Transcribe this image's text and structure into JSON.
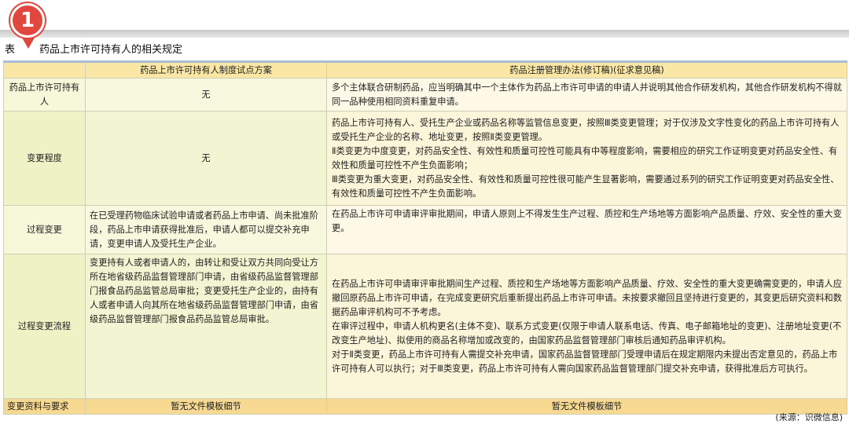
{
  "badge": {
    "number": "1"
  },
  "title": {
    "label": "表",
    "text": "药品上市许可持有人的相关规定"
  },
  "table": {
    "headers": [
      "",
      "药品上市许可持有人制度试点方案",
      "药品注册管理办法(修订稿)(征求意见稿)"
    ],
    "rows": [
      {
        "header": "药品上市许可持有人",
        "pilot": [
          "无"
        ],
        "rules": [
          "多个主体联合研制药品，应当明确其中一个主体作为药品上市许可申请的申请人并说明其他合作研发机构，其他合作研发机构不得就同一品种使用相同资料重复申请。"
        ]
      },
      {
        "header": "变更程度",
        "pilot": [
          "无"
        ],
        "rules": [
          "药品上市许可持有人、受托生产企业或药品名称等监管信息变更，按照Ⅲ类变更管理；对于仅涉及文字性变化的药品上市许可持有人或受托生产企业的名称、地址变更，按照Ⅱ类变更管理。",
          "Ⅱ类变更为中度变更，对药品安全性、有效性和质量可控性可能具有中等程度影响，需要相应的研究工作证明变更对药品安全性、有效性和质量可控性不产生负面影响；",
          "Ⅲ类变更为重大变更，对药品安全性、有效性和质量可控性很可能产生显著影响，需要通过系列的研究工作证明变更对药品安全性、有效性和质量可控性不产生负面影响。"
        ]
      },
      {
        "header": "过程变更",
        "pilot": [
          "在已受理药物临床试验申请或者药品上市申请、尚未批准阶段，药品上市申请获得批准后，申请人都可以提交补充申请，变更申请人及受托生产企业。"
        ],
        "rules": [
          "在药品上市许可申请审评审批期间，申请人原则上不得发生生产过程、质控和生产场地等方面影响产品质量、疗效、安全性的重大变更。"
        ]
      },
      {
        "header": "过程变更流程",
        "pilot": [
          "变更持有人或者申请人的，由转让和受让双方共同向受让方所在地省级药品监督管理部门申请，由省级药品监督管理部门报食品药品监管总局审批；变更受托生产企业的，由持有人或者申请人向其所在地省级药品监督管理部门申请，由省级药品监督管理部门报食品药品监管总局审批。"
        ],
        "rules": [
          "在药品上市许可申请审评审批期间生产过程、质控和生产场地等方面影响产品质量、疗效、安全性的重大变更确需变更的，申请人应撤回原药品上市许可申请，在完成变更研究后重新提出药品上市许可申请。未按要求撤回且坚持进行变更的，其变更后研究资料和数据药品审评机构可不予考虑。",
          "在审评过程中，申请人机构更名(主体不变)、联系方式变更(仅限于申请人联系电话、传真、电子邮箱地址的变更)、注册地址变更(不改变生产地址)、拟使用的商品名称增加或改变的，由国家药品监督管理部门审核后通知药品审评机构。",
          "对于Ⅱ类变更，药品上市许可持有人需提交补充申请，国家药品监督管理部门受理申请后在规定期限内未提出否定意见的，药品上市许可持有人可以执行；对于Ⅲ类变更，药品上市许可持有人需向国家药品监督管理部门提交补充申请，获得批准后方可执行。"
        ]
      }
    ],
    "last_row": {
      "header": "变更资料与要求",
      "pilot": "暂无文件模板细节",
      "rules": "暂无文件模板细节"
    }
  },
  "source": "(来源：识微信息)"
}
